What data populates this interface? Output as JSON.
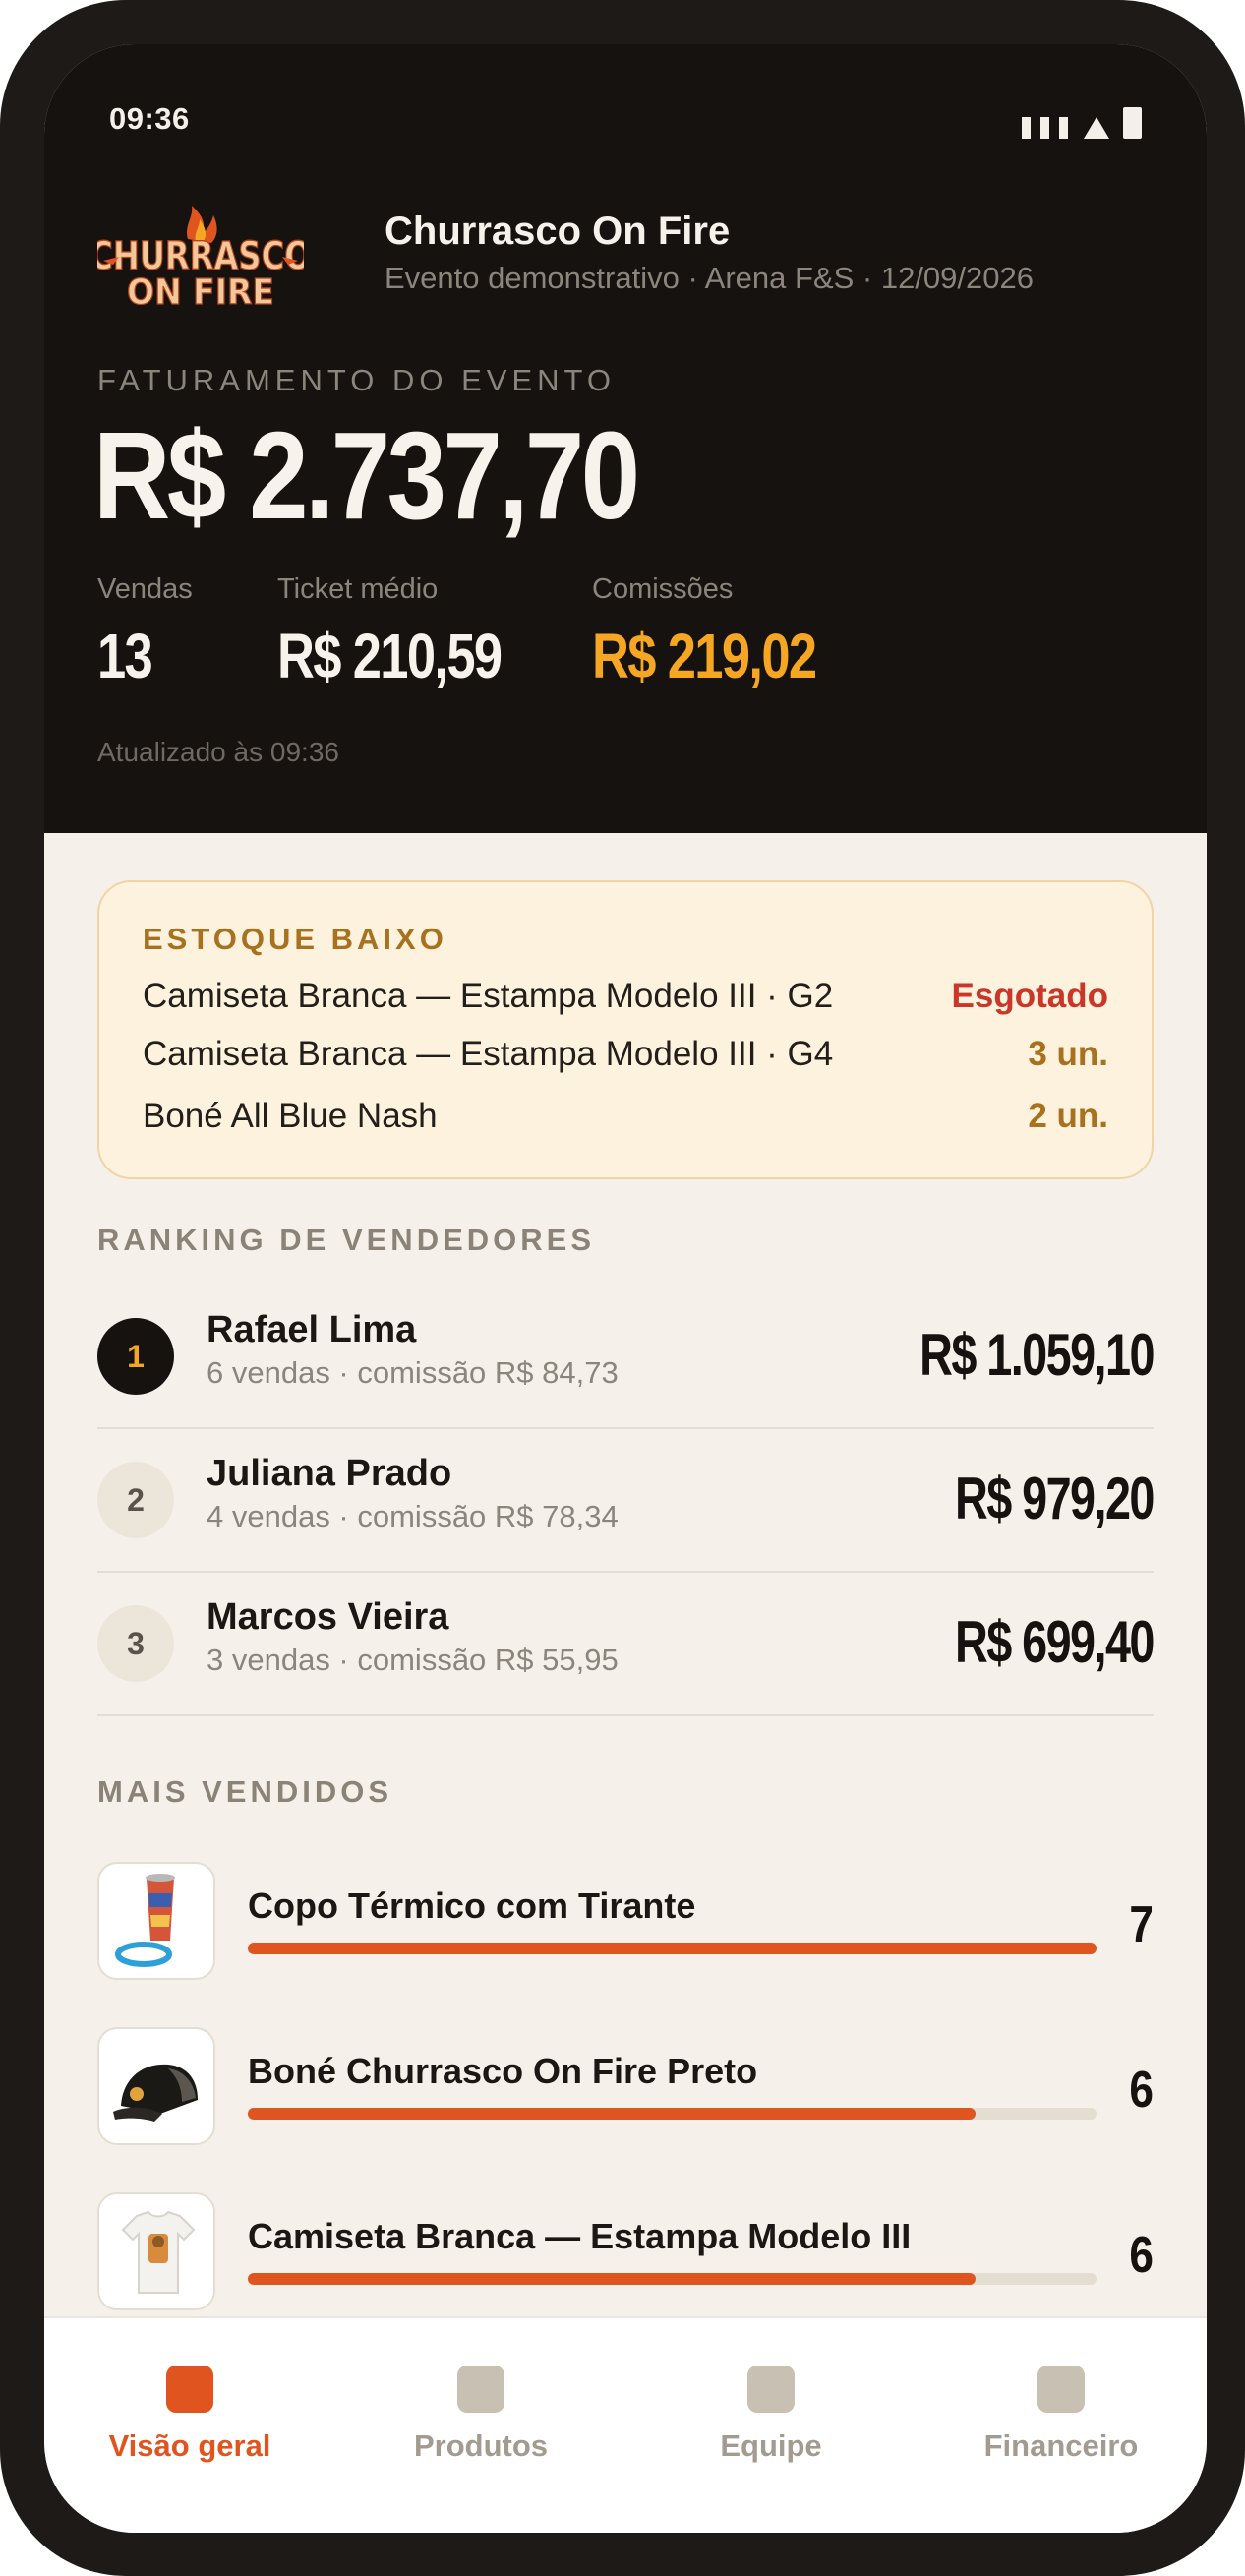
{
  "status_bar": {
    "time": "09:36"
  },
  "header": {
    "logo_text": [
      "CHURRASCO",
      "ON FIRE"
    ],
    "title": "Churrasco On Fire",
    "subtitle": "Evento demonstrativo · Arena F&S · 12/09/2026"
  },
  "revenue": {
    "label": "FATURAMENTO DO EVENTO",
    "value": "R$ 2.737,70"
  },
  "kpis": {
    "sales": {
      "label": "Vendas",
      "value": "13"
    },
    "avg_ticket": {
      "label": "Ticket médio",
      "value": "R$ 210,59"
    },
    "commissions": {
      "label": "Comissões",
      "value": "R$ 219,02"
    }
  },
  "updated_text": "Atualizado às 09:36",
  "low_stock": {
    "title": "ESTOQUE BAIXO",
    "items": [
      {
        "name": "Camiseta Branca — Estampa Modelo III · G2",
        "qty": "Esgotado"
      },
      {
        "name": "Camiseta Branca — Estampa Modelo III · G4",
        "qty": "3 un."
      },
      {
        "name": "Boné All Blue Nash",
        "qty": "2 un."
      }
    ]
  },
  "ranking": {
    "title": "RANKING DE VENDEDORES",
    "sellers": [
      {
        "position": "1",
        "name": "Rafael Lima",
        "detail": "6 vendas · comissão R$ 84,73",
        "total": "R$ 1.059,10"
      },
      {
        "position": "2",
        "name": "Juliana Prado",
        "detail": "4 vendas · comissão R$ 78,34",
        "total": "R$ 979,20"
      },
      {
        "position": "3",
        "name": "Marcos Vieira",
        "detail": "3 vendas · comissão R$ 55,95",
        "total": "R$ 699,40"
      }
    ]
  },
  "best_sellers": {
    "title": "MAIS VENDIDOS",
    "max_count": 7,
    "products": [
      {
        "name": "Copo Térmico com Tirante",
        "count": 7
      },
      {
        "name": "Boné Churrasco On Fire Preto",
        "count": 6
      },
      {
        "name": "Camiseta Branca — Estampa Modelo III",
        "count": 6
      }
    ]
  },
  "tabs": [
    {
      "label": "Visão geral",
      "active": true
    },
    {
      "label": "Produtos",
      "active": false
    },
    {
      "label": "Equipe",
      "active": false
    },
    {
      "label": "Financeiro",
      "active": false
    }
  ],
  "colors": {
    "accent": "#e0551f",
    "gold": "#f5a623",
    "warning": "#a8711d",
    "danger": "#c8372a",
    "header_bg": "#151210",
    "page_bg": "#f5f1ea"
  }
}
